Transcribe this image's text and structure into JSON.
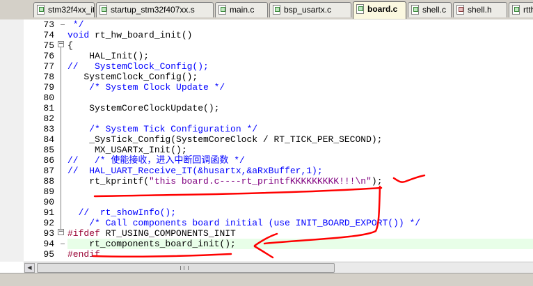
{
  "tabs": [
    {
      "label": "stm32f4xx_it.c",
      "type": "c",
      "active": false
    },
    {
      "label": "startup_stm32f407xx.s",
      "type": "s",
      "active": false
    },
    {
      "label": "main.c",
      "type": "c",
      "active": false
    },
    {
      "label": "bsp_usartx.c",
      "type": "c",
      "active": false
    },
    {
      "label": "board.c",
      "type": "c",
      "active": true
    },
    {
      "label": "shell.c",
      "type": "c",
      "active": false
    },
    {
      "label": "shell.h",
      "type": "h",
      "active": false
    },
    {
      "label": "rtth",
      "type": "c",
      "active": false
    }
  ],
  "editor": {
    "lines": [
      {
        "num": "73",
        "segments": [
          {
            "t": " */",
            "c": "cm"
          }
        ]
      },
      {
        "num": "74",
        "segments": [
          {
            "t": "void ",
            "c": "kw"
          },
          {
            "t": "rt_hw_board_init()",
            "c": "fn"
          }
        ]
      },
      {
        "num": "75",
        "segments": [
          {
            "t": "{",
            "c": "fn"
          }
        ]
      },
      {
        "num": "76",
        "segments": [
          {
            "t": "    HAL_Init();",
            "c": "fn"
          }
        ]
      },
      {
        "num": "77",
        "segments": [
          {
            "t": "//   SystemClock_Config();",
            "c": "cm"
          }
        ]
      },
      {
        "num": "78",
        "segments": [
          {
            "t": "   SystemClock_Config();",
            "c": "fn"
          }
        ]
      },
      {
        "num": "79",
        "segments": [
          {
            "t": "    /* System Clock Update */",
            "c": "cm"
          }
        ]
      },
      {
        "num": "80",
        "segments": [
          {
            "t": "",
            "c": "fn"
          }
        ]
      },
      {
        "num": "81",
        "segments": [
          {
            "t": "    SystemCoreClockUpdate();",
            "c": "fn"
          }
        ]
      },
      {
        "num": "82",
        "segments": [
          {
            "t": "",
            "c": "fn"
          }
        ]
      },
      {
        "num": "83",
        "segments": [
          {
            "t": "    /* System Tick Configuration */",
            "c": "cm"
          }
        ]
      },
      {
        "num": "84",
        "segments": [
          {
            "t": "    _SysTick_Config(SystemCoreClock / RT_TICK_PER_SECOND);",
            "c": "fn"
          }
        ]
      },
      {
        "num": "85",
        "segments": [
          {
            "t": "     MX_USARTx_Init();",
            "c": "fn"
          }
        ]
      },
      {
        "num": "86",
        "segments": [
          {
            "t": "//   /* 使能接收，进入中断回调函数 */",
            "c": "cm"
          }
        ]
      },
      {
        "num": "87",
        "segments": [
          {
            "t": "//  HAL_UART_Receive_IT(&husartx,&aRxBuffer,1);",
            "c": "cm"
          }
        ]
      },
      {
        "num": "88",
        "segments": [
          {
            "t": "    rt_kprintf(",
            "c": "fn"
          },
          {
            "t": "\"this board.c----rt_printfKKKKKKKKK!!!\\n\"",
            "c": "st"
          },
          {
            "t": ");",
            "c": "fn"
          }
        ]
      },
      {
        "num": "89",
        "segments": [
          {
            "t": "",
            "c": "fn"
          }
        ]
      },
      {
        "num": "90",
        "segments": [
          {
            "t": "",
            "c": "fn"
          }
        ]
      },
      {
        "num": "91",
        "segments": [
          {
            "t": "  //  rt_showInfo();",
            "c": "cm"
          }
        ]
      },
      {
        "num": "92",
        "segments": [
          {
            "t": "    /* Call components board initial (use INIT_BOARD_EXPORT()) */",
            "c": "cm"
          }
        ]
      },
      {
        "num": "93",
        "segments": [
          {
            "t": "#ifdef",
            "c": "pp"
          },
          {
            "t": " RT_USING_COMPONENTS_INIT",
            "c": "fn"
          }
        ]
      },
      {
        "num": "94",
        "segments": [
          {
            "t": "    rt_components_board_init();",
            "c": "fn"
          }
        ]
      },
      {
        "num": "95",
        "segments": [
          {
            "t": "#endif",
            "c": "pp"
          }
        ]
      }
    ]
  }
}
